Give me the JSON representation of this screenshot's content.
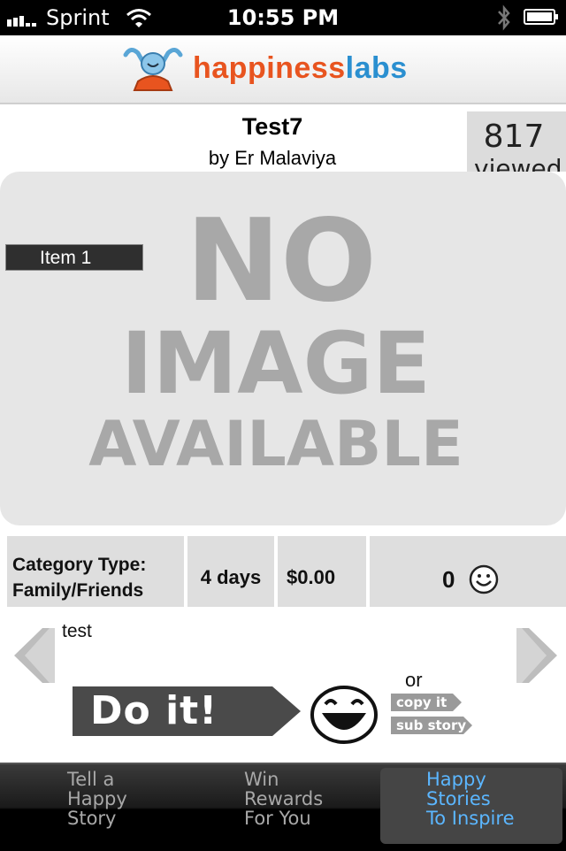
{
  "status_bar": {
    "carrier": "Sprint",
    "time": "10:55 PM"
  },
  "header": {
    "brand_part1": "happiness",
    "brand_part2": "labs"
  },
  "story": {
    "title": "Test7",
    "author": "by Er Malaviya",
    "views_count": "817",
    "views_label": "viewed",
    "image_item_label": "Item 1",
    "image_placeholder_lines": [
      "NO",
      "IMAGE",
      "AVAILABLE"
    ],
    "category_label": "Category Type:",
    "category_value": "Family/Friends",
    "duration": "4 days",
    "price": "$0.00",
    "likes": "0",
    "text": "test"
  },
  "actions": {
    "do_it": "Do it!",
    "or": "or",
    "copy_it": "copy it",
    "sub_story": "sub story"
  },
  "tabs": [
    {
      "label": "Tell a\nHappy\nStory",
      "active": false
    },
    {
      "label": "Win\nRewards\nFor You",
      "active": false
    },
    {
      "label": "Happy\nStories\nTo Inspire",
      "active": true
    }
  ],
  "colors": {
    "brand_orange": "#e8541f",
    "brand_blue": "#2a8fd0",
    "active_tab": "#5bb6ff"
  }
}
